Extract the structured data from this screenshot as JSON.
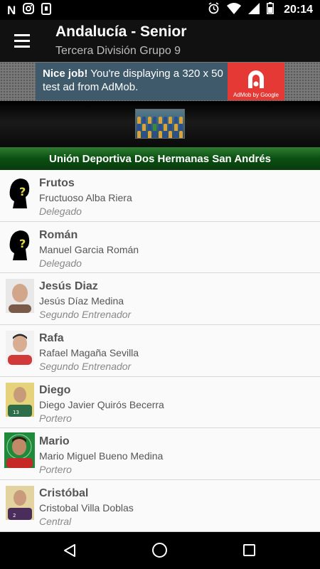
{
  "status_bar": {
    "time": "20:14",
    "left_icons": [
      "notification-n-icon",
      "instagram-icon",
      "clipboard-icon"
    ],
    "right_icons": [
      "alarm-icon",
      "wifi-icon",
      "signal-icon",
      "battery-icon"
    ]
  },
  "app_bar": {
    "title": "Andalucía - Senior",
    "subtitle": "Tercera División Grupo 9",
    "menu_icon": "hamburger-menu-icon"
  },
  "ad": {
    "headline": "Nice job!",
    "body": "You're displaying a 320 x 50 test ad from AdMob.",
    "brand": "AdMob by Google",
    "brand_color": "#e53935",
    "background_color": "#3f5a6b"
  },
  "team": {
    "name": "Unión Deportiva Dos Hermanas San Andrés",
    "bar_color": "#0b4f12"
  },
  "members": [
    {
      "nick": "Frutos",
      "full_name": "Fructuoso Alba Riera",
      "role": "Delegado",
      "avatar": "unknown-silhouette"
    },
    {
      "nick": "Román",
      "full_name": "Manuel Garcia Román",
      "role": "Delegado",
      "avatar": "unknown-silhouette"
    },
    {
      "nick": "Jesús Diaz",
      "full_name": "Jesús Díaz Medina",
      "role": "Segundo Entrenador",
      "avatar": "photo"
    },
    {
      "nick": "Rafa",
      "full_name": "Rafael Magaña Sevilla",
      "role": "Segundo Entrenador",
      "avatar": "photo"
    },
    {
      "nick": "Diego",
      "full_name": "Diego Javier Quirós Becerra",
      "role": "Portero",
      "avatar": "photo"
    },
    {
      "nick": "Mario",
      "full_name": "Mario Miguel Bueno Medina",
      "role": "Portero",
      "avatar": "photo"
    },
    {
      "nick": "Cristóbal",
      "full_name": "Cristobal Villa Doblas",
      "role": "Central",
      "avatar": "photo"
    }
  ],
  "nav_bar": {
    "icons": [
      "back-icon",
      "home-icon",
      "recents-icon"
    ]
  }
}
